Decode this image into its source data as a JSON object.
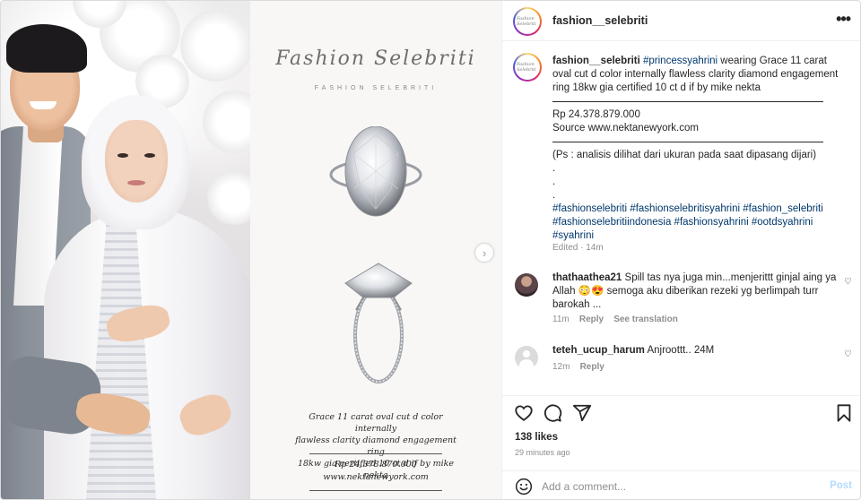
{
  "account": {
    "username": "fashion__selebriti",
    "avatar_text": "Fashion Selebriti"
  },
  "media_card": {
    "brand_script": "Fashion Selebriti",
    "brand_caps": "FASHION SELEBRITI",
    "caption_line1": "Grace 11 carat oval cut d color internally",
    "caption_line2": "flawless clarity diamond engagement ring",
    "caption_line3": "18kw gia certified 10 ct d if by mike nekta",
    "price": "Rp 24.378.879.000",
    "source": "www.nektanewyork.com"
  },
  "caption": {
    "username": "fashion__selebriti",
    "mention": "#princessyahrini",
    "text": " wearing Grace 11 carat oval cut d color internally flawless clarity diamond engagement ring 18kw gia certified 10 ct d if by mike nekta",
    "price": "Rp 24.378.879.000",
    "source": "Source www.nektanewyork.com",
    "note": "(Ps : analisis dilihat dari ukuran pada saat dipasang dijari)",
    "dot": ".",
    "tag1": "#fashionselebriti",
    "tag2": "#fashionselebritisyahrini",
    "tag3": "#fashion_selebriti",
    "tag4": "#fashionselebritiindonesia",
    "tag5": "#fashionsyahrini",
    "tag6": "#ootdsyahrini",
    "tag7": "#syahrini",
    "edited": "Edited · 14m"
  },
  "comments": [
    {
      "username": "thathaathea21",
      "text_a": " Spill tas nya juga min...menjerittt ginjal aing ya Allah ",
      "emoji": "😳😍",
      "text_b": " semoga aku diberikan rezeki yg berlimpah turr barokah ...",
      "time": "11m",
      "reply": "Reply",
      "translate": "See translation"
    },
    {
      "username": "teteh_ucup_harum",
      "text": " Anjroottt.. 24M",
      "time": "12m",
      "reply": "Reply"
    }
  ],
  "stats": {
    "likes": "138 likes",
    "ago": "29 minutes ago"
  },
  "composer": {
    "placeholder": "Add a comment...",
    "post_label": "Post"
  },
  "icons": [
    "more-icon",
    "heart-icon",
    "comment-icon",
    "share-icon",
    "bookmark-icon",
    "emoji-icon",
    "chevron-right-icon"
  ],
  "colors": {
    "link": "#00376b",
    "muted": "#8e8e8e",
    "post_disabled": "#b3dbff",
    "text": "#262626"
  }
}
